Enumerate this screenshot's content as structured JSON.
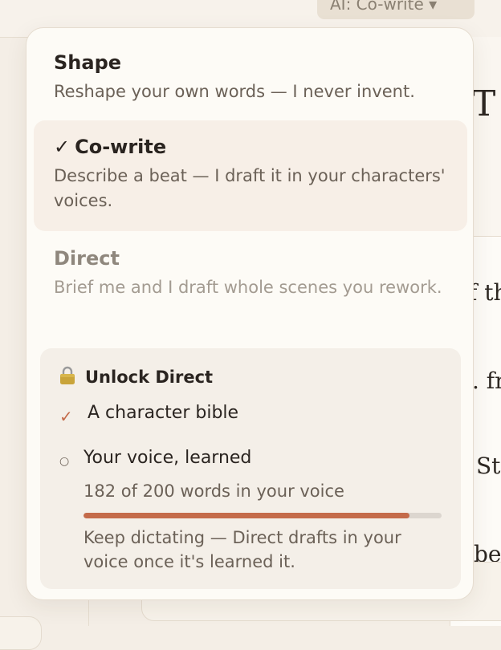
{
  "background": {
    "mode_pill_label": "AI: Co-write ▾",
    "heading_fragment": "T",
    "text_fragments": [
      "f th",
      ". fr",
      "Str",
      "be"
    ]
  },
  "mode_menu": {
    "options": [
      {
        "title": "Shape",
        "description": "Reshape your own words — I never invent.",
        "selected": false,
        "locked": false
      },
      {
        "title": "Co-write",
        "description": "Describe a beat — I draft it in your characters' voices.",
        "selected": true,
        "locked": false
      },
      {
        "title": "Direct",
        "description": "Brief me and I draft whole scenes you rework.",
        "selected": false,
        "locked": true
      }
    ],
    "selected_check": "✓",
    "unlock": {
      "icon": "lock-icon",
      "title": "Unlock Direct",
      "requirements": [
        {
          "label": "A character bible",
          "done": true,
          "mark": "✓"
        },
        {
          "label": "Your voice, learned",
          "done": false,
          "mark": "○"
        }
      ],
      "progress": {
        "current": 182,
        "target": 200,
        "text": "182 of 200 words in your voice"
      },
      "hint": "Keep dictating — Direct drafts in your voice once it's learned it."
    }
  },
  "colors": {
    "accent": "#c46b4a",
    "selected_bg": "#f7efe7",
    "unlock_bg": "#f4efe8",
    "text_primary": "#2a2420",
    "text_secondary": "#6b6157",
    "text_muted": "#a39b91"
  }
}
